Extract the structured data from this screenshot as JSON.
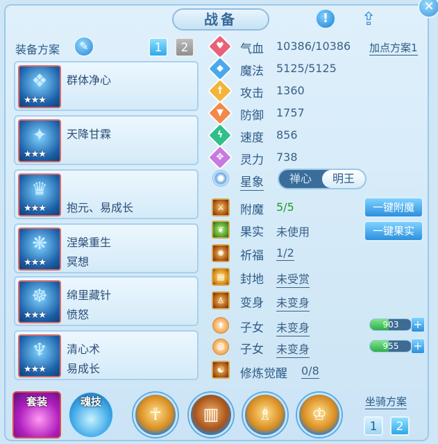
{
  "title": "战备",
  "equip_plan_label": "装备方案",
  "plan_buttons": [
    "1",
    "2"
  ],
  "attr_plan_link": "加点方案1",
  "skills": [
    {
      "name": "群体净心",
      "sub": "",
      "stars": "★★★"
    },
    {
      "name": "天降甘霖",
      "sub": "",
      "stars": "★★★"
    },
    {
      "name": "",
      "sub": "抱元、易成长",
      "stars": "★★★"
    },
    {
      "name": "涅槃重生",
      "sub": "冥想",
      "stars": "★★★"
    },
    {
      "name": "绵里藏针",
      "sub": "愤怒",
      "stars": "★★★"
    },
    {
      "name": "清心术",
      "sub": "易成长",
      "stars": "★★★"
    }
  ],
  "stats": [
    {
      "name": "气血",
      "value": "10386/10386",
      "color": "#e8627a",
      "icon": "heart-icon"
    },
    {
      "name": "魔法",
      "value": "5125/5125",
      "color": "#4aa8ee",
      "icon": "mana-icon"
    },
    {
      "name": "攻击",
      "value": "1360",
      "color": "#f4b43a",
      "icon": "sword-icon"
    },
    {
      "name": "防御",
      "value": "1757",
      "color": "#f2894a",
      "icon": "shield-icon"
    },
    {
      "name": "速度",
      "value": "856",
      "color": "#2fc08a",
      "icon": "lightning-icon"
    },
    {
      "name": "灵力",
      "value": "738",
      "color": "#c77ae0",
      "icon": "spirit-icon"
    }
  ],
  "constellation": {
    "label": "星象",
    "options": [
      "禅心",
      "明王"
    ],
    "selected": "明王"
  },
  "enhance": {
    "label": "附魔",
    "value": "5/5",
    "button": "一键附魔"
  },
  "fruit": {
    "label": "果实",
    "value": "未使用",
    "button": "一键果实"
  },
  "blessing": {
    "label": "祈福",
    "value": "1/2"
  },
  "fengdi": {
    "label": "封地",
    "value": "未受赏"
  },
  "transform": {
    "label": "变身",
    "value": "未变身"
  },
  "children": [
    {
      "label": "子女",
      "value": "未变身",
      "points": "903",
      "fill_fraction": 0.45
    },
    {
      "label": "子女",
      "value": "未变身",
      "points": "955",
      "fill_fraction": 0.45
    }
  ],
  "awakening": {
    "label": "修炼觉醒",
    "value": "0/8"
  },
  "bottom": {
    "suit_label": "套装",
    "soul_label": "魂技",
    "mount_label": "坐骑方案",
    "mount_buttons": [
      "1",
      "2"
    ]
  }
}
